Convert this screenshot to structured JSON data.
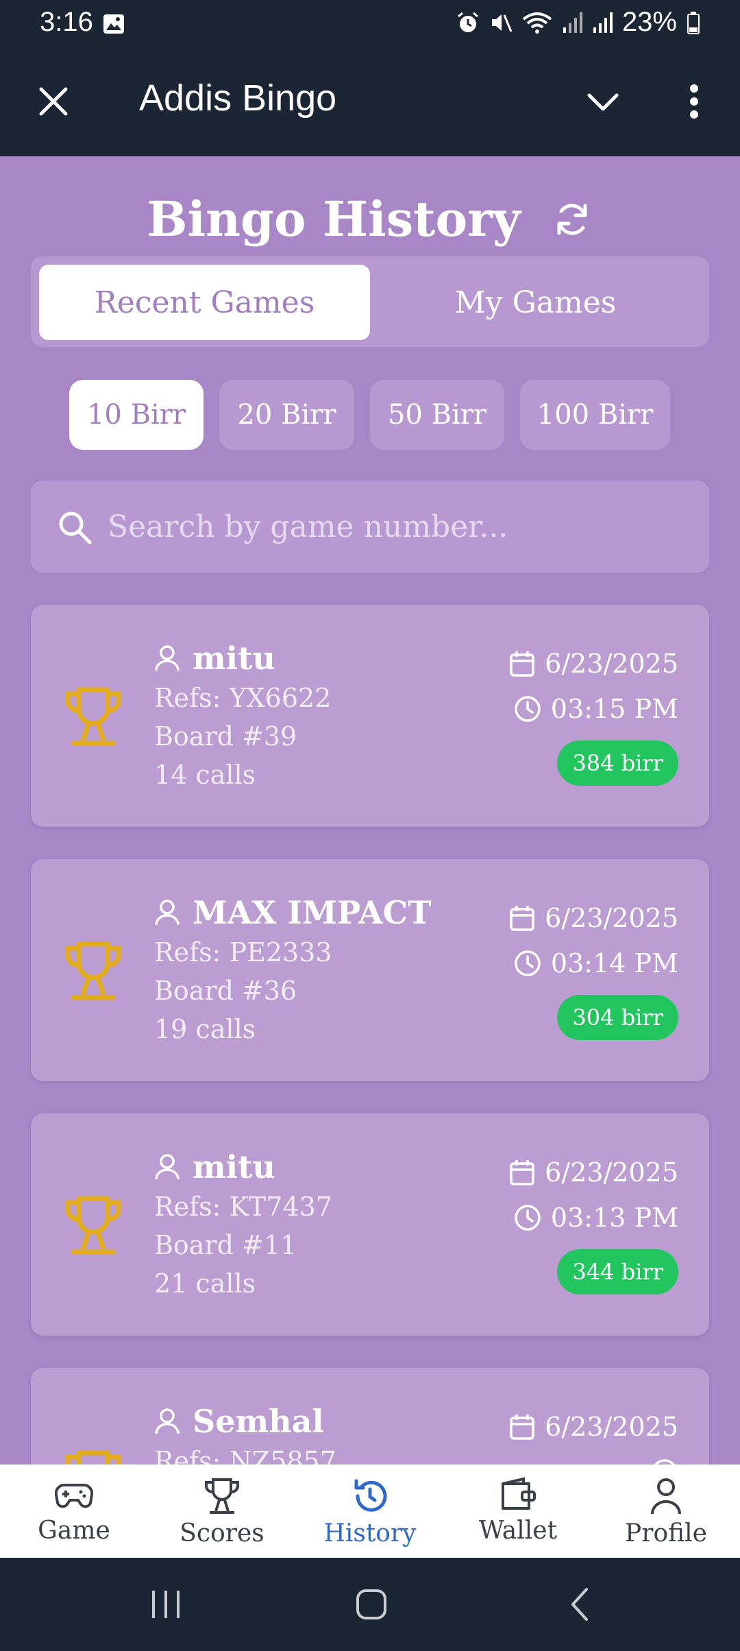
{
  "status_bar": {
    "time": "3:16",
    "battery": "23%"
  },
  "app_bar": {
    "title": "Addis Bingo"
  },
  "page": {
    "title": "Bingo History",
    "tabs": [
      {
        "label": "Recent Games"
      },
      {
        "label": "My Games"
      }
    ],
    "filters": [
      {
        "label": "10 Birr"
      },
      {
        "label": "20 Birr"
      },
      {
        "label": "50 Birr"
      },
      {
        "label": "100 Birr"
      }
    ],
    "search": {
      "placeholder": "Search by game number..."
    }
  },
  "games": [
    {
      "user": "mitu",
      "refs": "Refs: YX6622",
      "board": "Board #39",
      "calls": "14 calls",
      "date": "6/23/2025",
      "time": "03:15 PM",
      "prize": "384 birr"
    },
    {
      "user": "MAX IMPACT",
      "refs": "Refs: PE2333",
      "board": "Board #36",
      "calls": "19 calls",
      "date": "6/23/2025",
      "time": "03:14 PM",
      "prize": "304 birr"
    },
    {
      "user": "mitu",
      "refs": "Refs: KT7437",
      "board": "Board #11",
      "calls": "21 calls",
      "date": "6/23/2025",
      "time": "03:13 PM",
      "prize": "344 birr"
    },
    {
      "user": "Semhal",
      "refs": "Refs: NZ5857",
      "board": "",
      "calls": "",
      "date": "6/23/2025",
      "time": "",
      "prize": ""
    }
  ],
  "bottom_nav": [
    {
      "label": "Game",
      "icon": "gamepad-icon"
    },
    {
      "label": "Scores",
      "icon": "trophy-icon"
    },
    {
      "label": "History",
      "icon": "history-icon"
    },
    {
      "label": "Wallet",
      "icon": "wallet-icon"
    },
    {
      "label": "Profile",
      "icon": "person-icon"
    }
  ],
  "colors": {
    "accent": "#a27dc0",
    "background": "#a987c6",
    "prize": "#22c55e",
    "active_nav": "#2f68c8",
    "trophy": "#e2ab1c"
  }
}
